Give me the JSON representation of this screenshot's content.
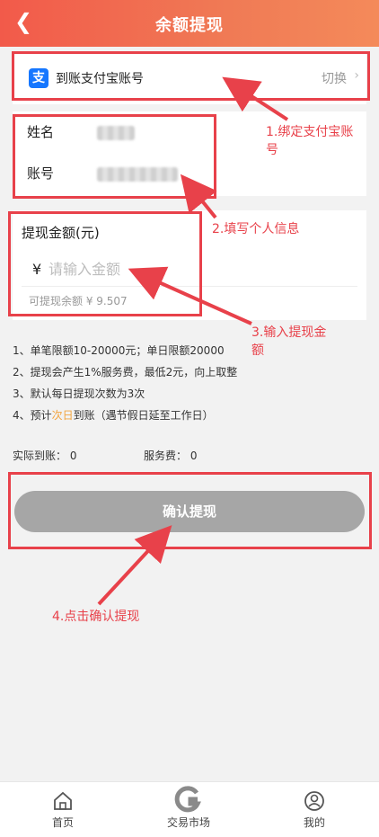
{
  "header": {
    "title": "余额提现",
    "back_icon": "chevron-left-icon"
  },
  "alipay": {
    "label": "到账支付宝账号",
    "switch": "切换",
    "icon": "alipay-icon",
    "icon_glyph": "支"
  },
  "info": {
    "name_label": "姓名",
    "account_label": "账号"
  },
  "amount": {
    "title": "提现金额(元)",
    "currency": "¥",
    "placeholder": "请输入金额",
    "available": "可提现余额 ¥ 9.507"
  },
  "rules": {
    "r1": "1、单笔限额10-20000元；单日限额20000",
    "r2": "2、提现会产生1%服务费，最低2元，向上取整",
    "r3": "3、默认每日提现次数为3次",
    "r4_prefix": "4、预计",
    "r4_highlight": "次日",
    "r4_suffix": "到账（遇节假日延至工作日）"
  },
  "summary": {
    "actual": "实际到账： 0",
    "fee": "服务费： 0"
  },
  "confirm_button": "确认提现",
  "annotations": {
    "a1_line1": "1.绑定支付宝账",
    "a1_line2": "号",
    "a2": "2.填写个人信息",
    "a3_line1": "3.输入提现金",
    "a3_line2": "额",
    "a4": "4.点击确认提现"
  },
  "tabbar": {
    "home": "首页",
    "market": "交易市场",
    "mine": "我的"
  },
  "colors": {
    "header_start": "#f25a4a",
    "header_end": "#f48a5a",
    "annotation": "#e8414a",
    "highlight": "#f3a43e",
    "button": "#a6a6a6"
  }
}
